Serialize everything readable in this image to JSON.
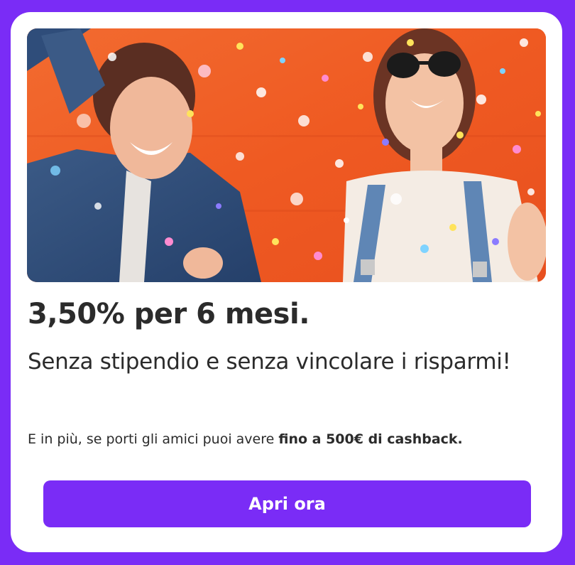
{
  "colors": {
    "frame": "#7a2cf6",
    "card": "#ffffff",
    "text": "#2b2b2b",
    "cta_background": "#7a2cf6",
    "cta_text": "#ffffff",
    "hero_backdrop": "#f0622a"
  },
  "promo": {
    "image": {
      "icon": "celebration-photo",
      "depicts": "two-women-laughing-in-confetti"
    },
    "headline": "3,50% per 6 mesi.",
    "subheadline": "Senza stipendio e senza vincolare i risparmi!",
    "body_prefix": "E in più, se porti gli amici puoi avere ",
    "body_emphasis": "fino a 500€ di cashback.",
    "cta_label": "Apri ora"
  }
}
